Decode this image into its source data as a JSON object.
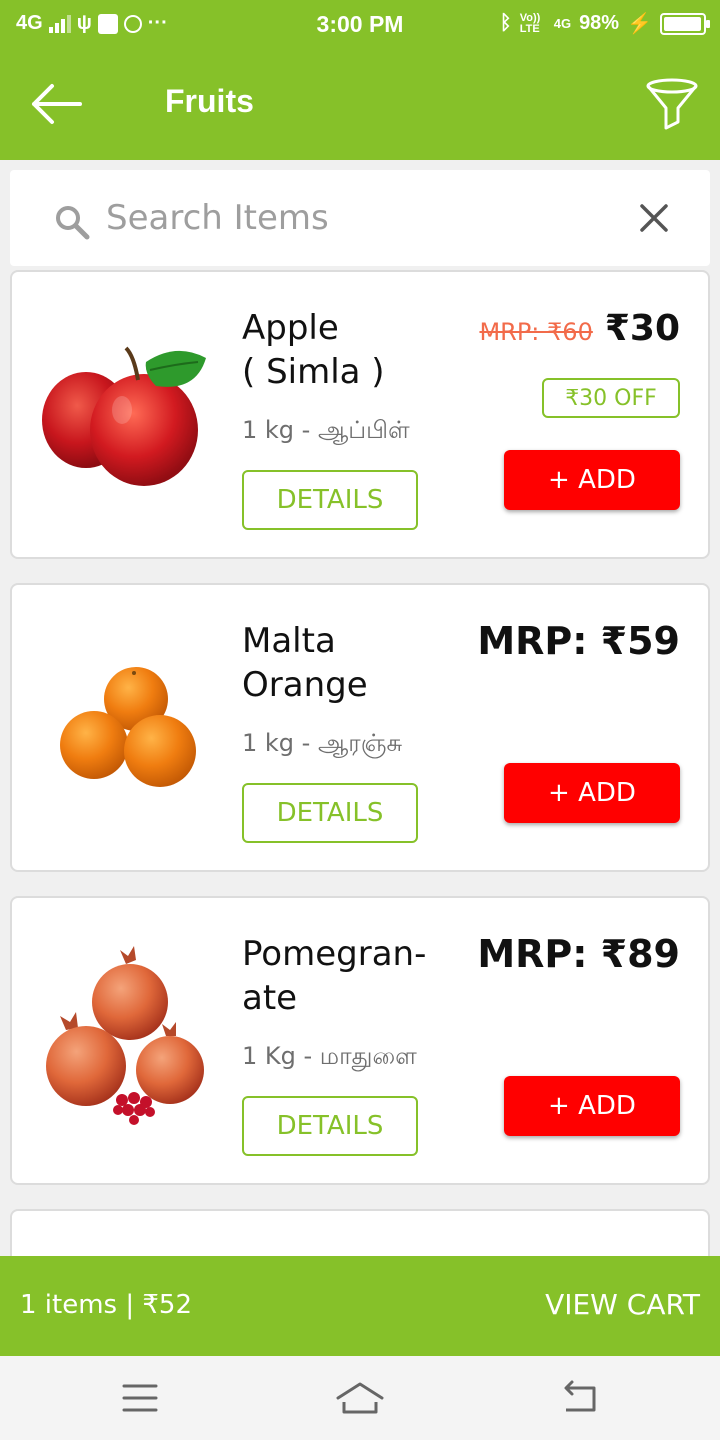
{
  "status_bar": {
    "network": "4G",
    "time": "3:00 PM",
    "volte": "Vo)) LTE",
    "data_type": "4G",
    "battery": "98%",
    "battery_level": 0.98
  },
  "app_bar": {
    "title": "Fruits",
    "back_icon": "arrow-left-icon",
    "filter_icon": "funnel-icon"
  },
  "search": {
    "placeholder": "Search Items",
    "value": ""
  },
  "products": [
    {
      "name_line1": "Apple",
      "name_line2": "( Simla )",
      "quantity": "1 kg - ஆப்பிள்",
      "details_label": "DETAILS",
      "old_price": "MRP: ₹60",
      "price": "₹30",
      "discount": "₹30 OFF",
      "add_label": "+ ADD"
    },
    {
      "name_line1": "Malta",
      "name_line2": "Orange",
      "quantity": "1 kg -  ஆரஞ்சு",
      "details_label": "DETAILS",
      "mrp": "MRP: ₹59",
      "add_label": "+ ADD"
    },
    {
      "name_line1": "Pomegran-",
      "name_line2": "ate",
      "quantity": "1 Kg - மாதுளை",
      "details_label": "DETAILS",
      "mrp": "MRP: ₹89",
      "add_label": "+ ADD"
    }
  ],
  "cart": {
    "summary": "1 items | ₹52",
    "view_label": "VIEW CART"
  },
  "colors": {
    "brand": "#86c129",
    "add_button": "#ff0000",
    "strike_price": "#f26b4a"
  }
}
